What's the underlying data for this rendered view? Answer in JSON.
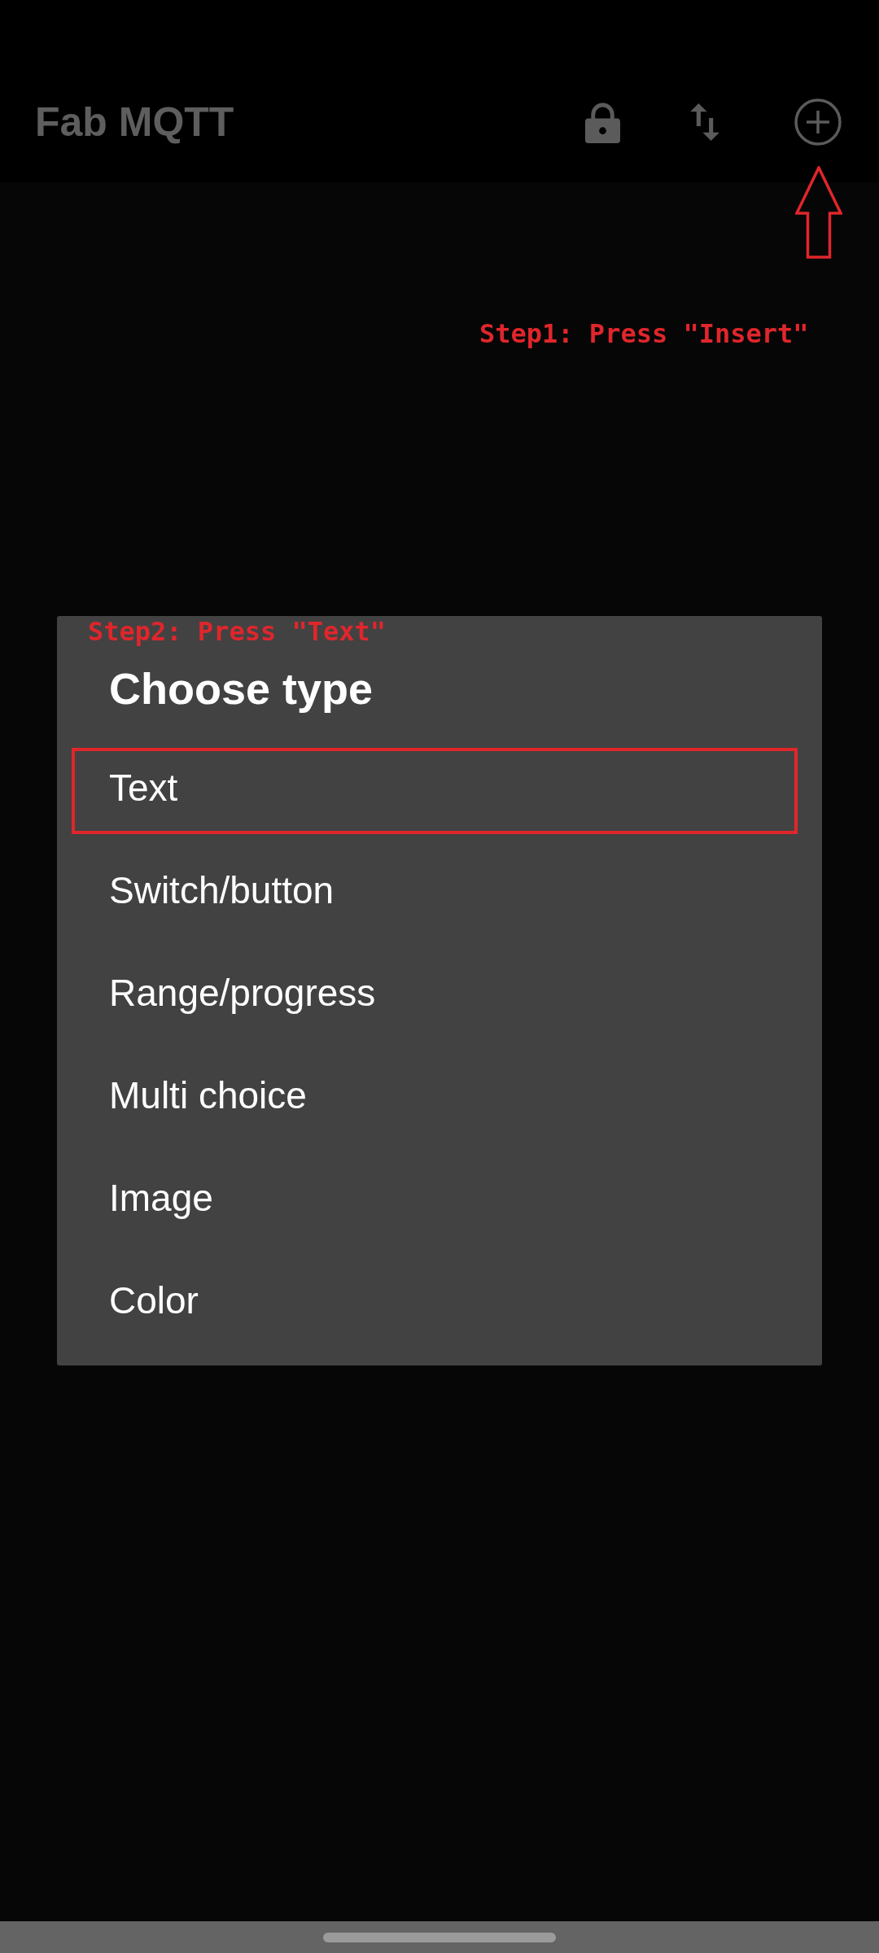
{
  "app_bar": {
    "title": "Fab MQTT"
  },
  "annotations": [
    {
      "text": "Step1: Press \"Insert\""
    },
    {
      "text": "Step2: Press \"Text\""
    }
  ],
  "dialog": {
    "title": "Choose type",
    "items": [
      {
        "label": "Text",
        "highlighted": true
      },
      {
        "label": "Switch/button",
        "highlighted": false
      },
      {
        "label": "Range/progress",
        "highlighted": false
      },
      {
        "label": "Multi choice",
        "highlighted": false
      },
      {
        "label": "Image",
        "highlighted": false
      },
      {
        "label": "Color",
        "highlighted": false
      }
    ]
  }
}
